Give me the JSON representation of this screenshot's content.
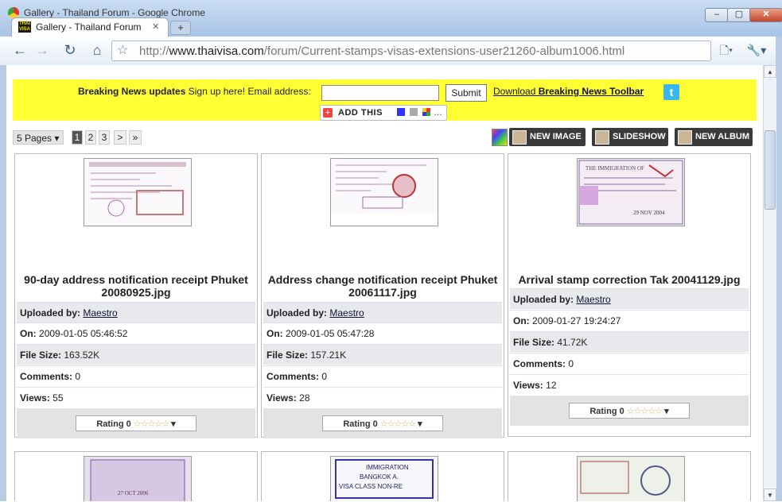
{
  "window": {
    "title": "Gallery - Thailand Forum - Google Chrome",
    "minimize": "–",
    "maximize": "▢",
    "close": "✕"
  },
  "tab": {
    "label": "Gallery - Thailand Forum",
    "close": "✕",
    "favicon_text": "THAI VISA",
    "new_tab": "+"
  },
  "nav": {
    "back": "←",
    "forward": "→",
    "reload": "↻",
    "home": "⌂",
    "go": "▶",
    "page": "🗋▾",
    "wrench": "🔧▾"
  },
  "address": {
    "prefix": "http://",
    "domain": "www.thaivisa.com",
    "path": "/forum/Current-stamps-visas-extensions-user21260-album1006.html",
    "star": "☆"
  },
  "banner": {
    "bold": "Breaking News updates",
    "text": "Sign up here! Email address:",
    "email_value": "",
    "submit": "Submit",
    "download_prefix": "Download ",
    "download_bold": "Breaking News Toolbar",
    "twitter": "t",
    "addthis": "ADD THIS"
  },
  "pagination": {
    "pages_label": "5 Pages",
    "pages": [
      "1",
      "2",
      "3"
    ],
    "current": "1",
    "next": ">",
    "last": "»"
  },
  "actions": {
    "new_image": "NEW IMAGE",
    "slideshow": "SLIDESHOW",
    "new_album": "NEW ALBUM"
  },
  "labels": {
    "uploaded_by": "Uploaded by:",
    "on": "On:",
    "file_size": "File Size:",
    "comments": "Comments:",
    "views": "Views:",
    "rating": "Rating 0",
    "stars": "☆☆☆☆☆",
    "dropdown": "▾"
  },
  "items": [
    {
      "title_line1": "90-day address notification receipt Phuket",
      "title_line2": "20080925.jpg",
      "uploader": "Maestro",
      "date": "2009-01-05 05:46:52",
      "size": "163.52K",
      "comments": "0",
      "views": "55"
    },
    {
      "title_line1": "Address change notification receipt Phuket",
      "title_line2": "20061117.jpg",
      "uploader": "Maestro",
      "date": "2009-01-05 05:47:28",
      "size": "157.21K",
      "comments": "0",
      "views": "28"
    },
    {
      "title_line1": "Arrival stamp correction Tak 20041129.jpg",
      "title_line2": "",
      "uploader": "Maestro",
      "date": "2009-01-27 19:24:27",
      "size": "41.72K",
      "comments": "0",
      "views": "12"
    }
  ],
  "thumb_text": {
    "t3_lines": [
      "THE IMMIGRATION OF",
      "29 NOV 2004"
    ],
    "t5_lines": [
      "IMMIGRATION",
      "BANGKOK A.",
      "VISA CLASS NON-RE"
    ],
    "t4_lines": [
      "27 OCT 2006"
    ]
  }
}
